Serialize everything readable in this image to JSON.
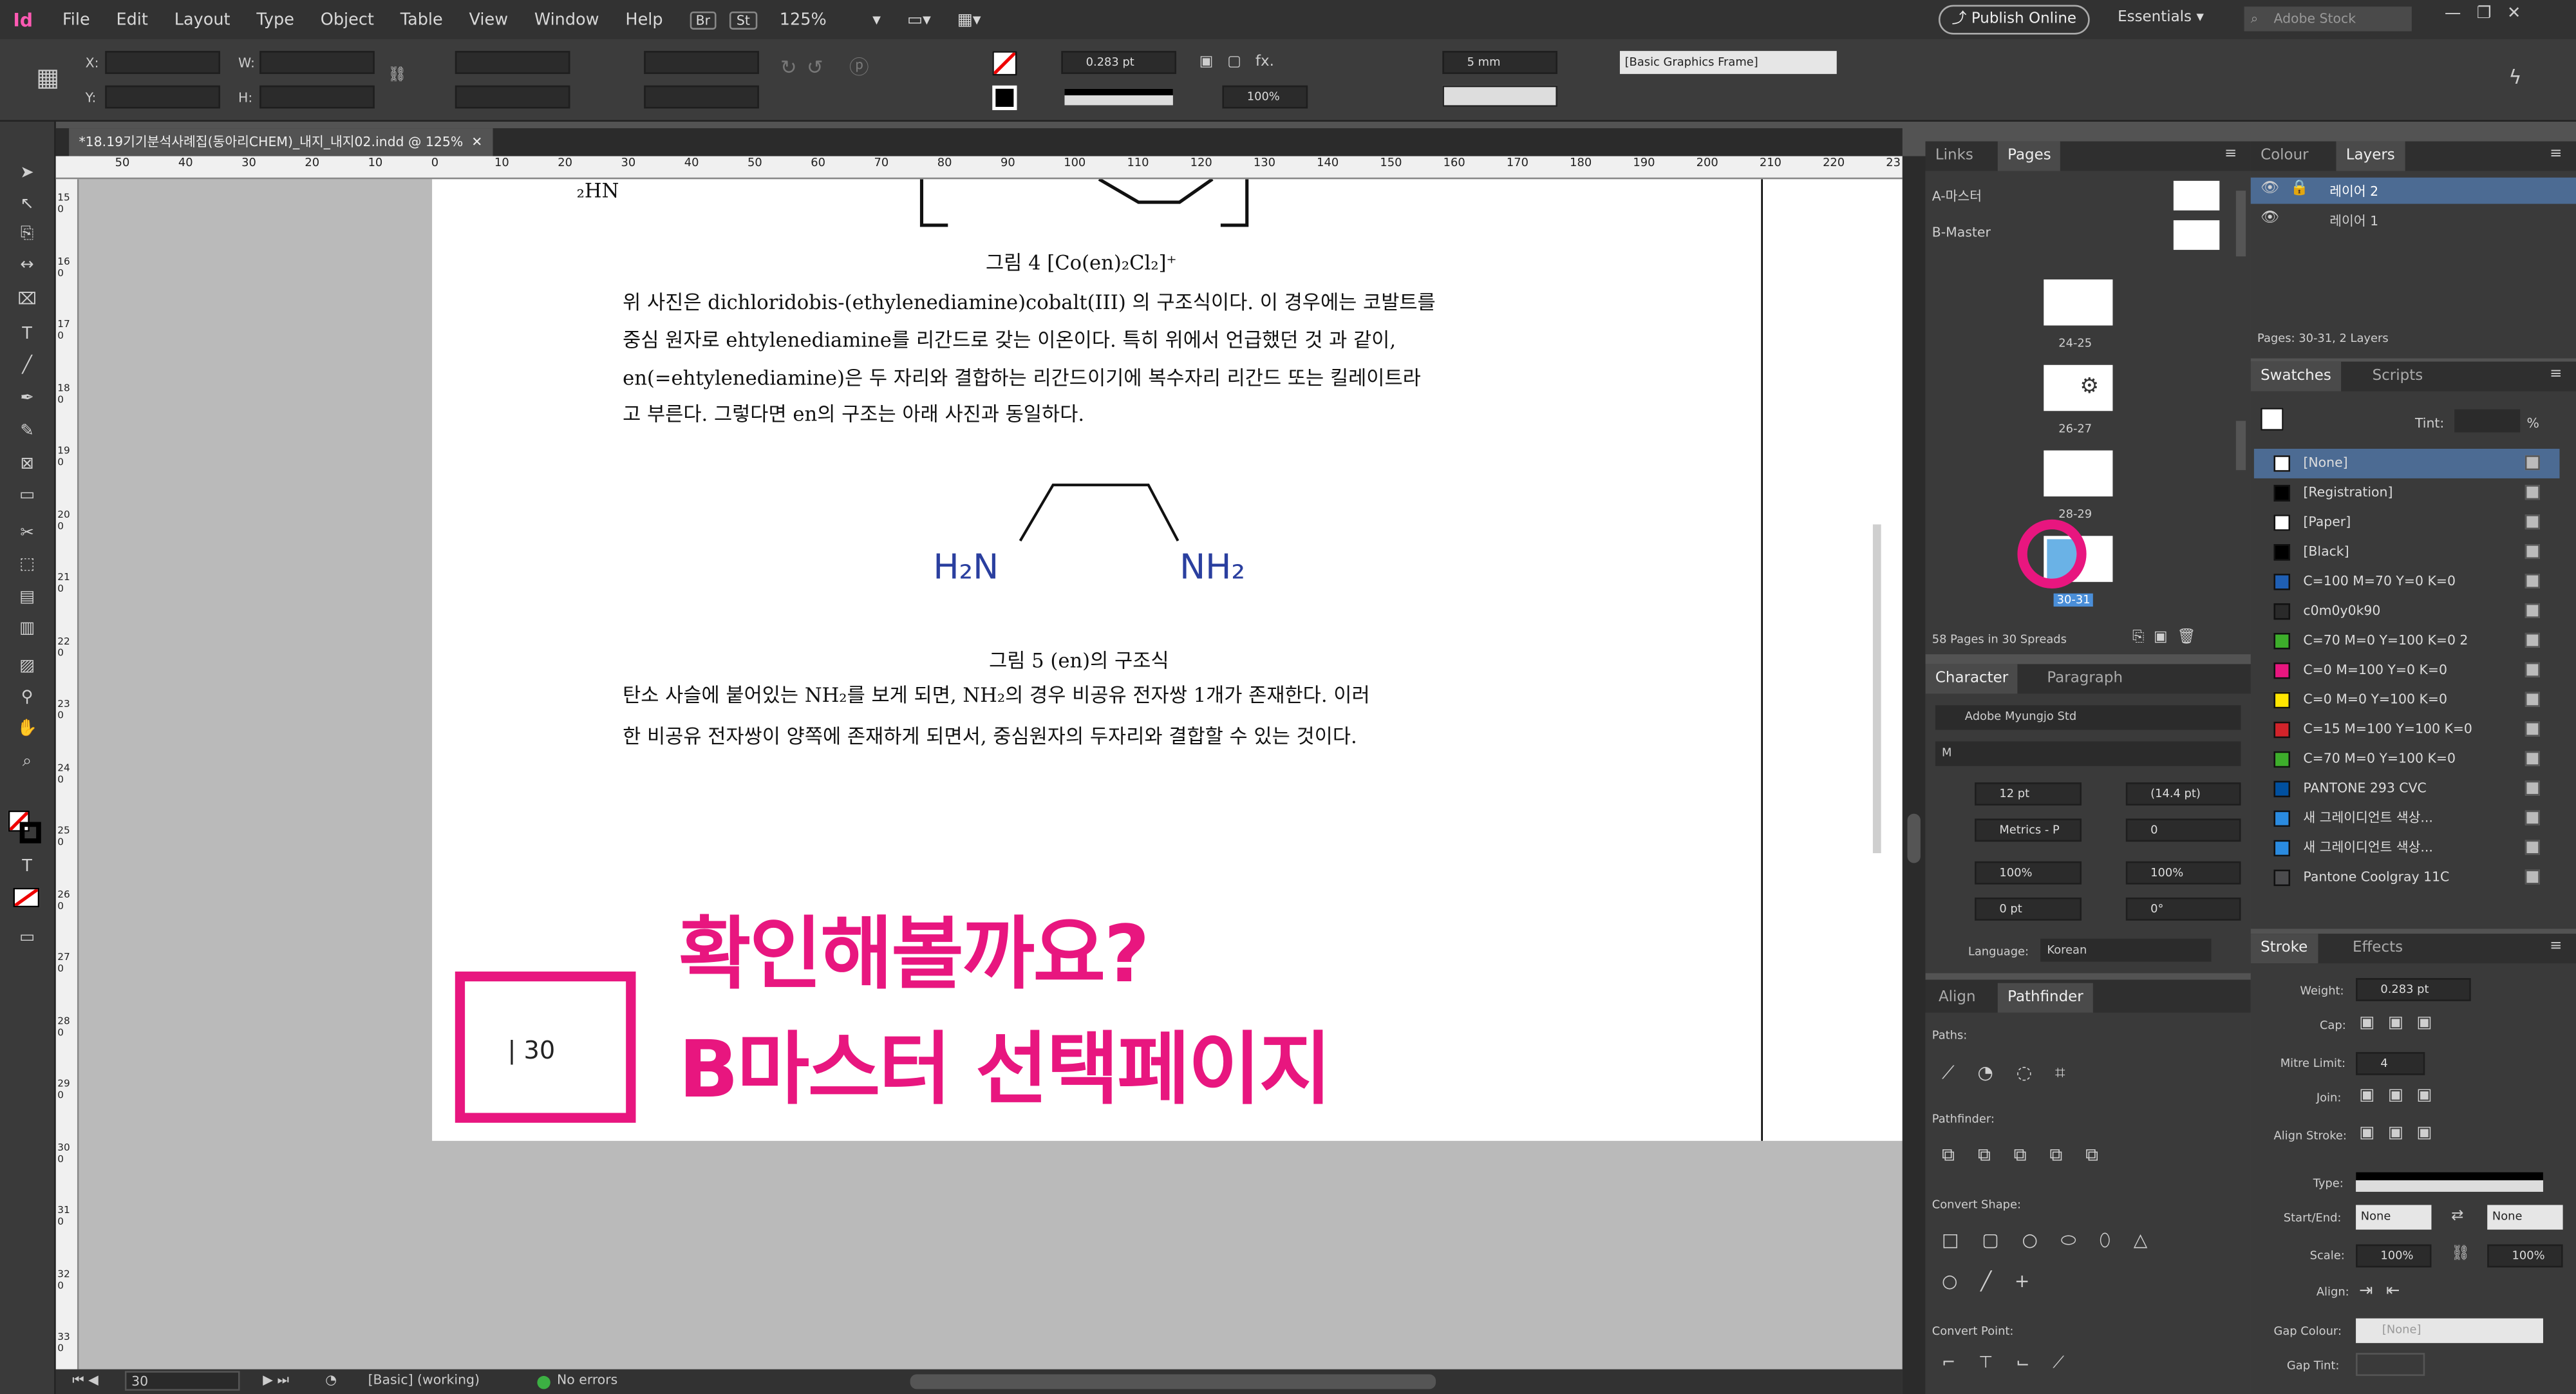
{
  "app": {
    "logo": "Id",
    "menu": [
      "File",
      "Edit",
      "Layout",
      "Type",
      "Object",
      "Table",
      "View",
      "Window",
      "Help"
    ],
    "br": "Br",
    "st": "St",
    "zoom": "125%"
  },
  "topright": {
    "publish": "Publish Online",
    "workspace": "Essentials",
    "search_placeholder": "Adobe Stock"
  },
  "control": {
    "x_label": "X:",
    "y_label": "Y:",
    "w_label": "W:",
    "h_label": "H:",
    "stroke_weight": "0.283 pt",
    "scale": "100%",
    "size_mm": "5 mm",
    "style": "[Basic Graphics Frame]"
  },
  "doc": {
    "tab": "*18.19기기분석사례집(동아리CHEM)_내지_내지02.indd @ 125%"
  },
  "ruler": {
    "h": [
      "50",
      "40",
      "30",
      "20",
      "10",
      "0",
      "10",
      "20",
      "30",
      "40",
      "50",
      "60",
      "70",
      "80",
      "90",
      "100",
      "110",
      "120",
      "130",
      "140",
      "150",
      "160",
      "170",
      "180",
      "190",
      "200",
      "210",
      "220",
      "23"
    ],
    "v": [
      "150",
      "160",
      "170",
      "180",
      "190",
      "200",
      "210",
      "220",
      "230",
      "240",
      "250",
      "260",
      "270",
      "280",
      "290",
      "300",
      "310",
      "320",
      "330"
    ]
  },
  "page": {
    "fig4_caption": "그림 4 [Co(en)₂Cl₂]⁺",
    "para1": [
      "위 사진은 dichloridobis-(ethylenediamine)cobalt(III) 의 구조식이다. 이 경우에는 코발트를",
      "중심 원자로 ehtylenediamine를 리간드로 갖는 이온이다. 특히 위에서 언급했던 것 과 같이,",
      "en(=ehtylenediamine)은 두 자리와 결합하는 리간드이기에 복수자리 리간드 또는 킬레이트라",
      "고 부른다. 그렇다면 en의 구조는 아래 사진과 동일하다."
    ],
    "h2n_left": "H₂N",
    "nh2_right": "NH₂",
    "top_frag": "₂HN",
    "fig5_caption": "그림 5 (en)의 구조식",
    "para2": [
      "탄소 사슬에 붙어있는 NH₂를 보게 되면, NH₂의 경우 비공유 전자쌍 1개가 존재한다. 이러",
      "한 비공유 전자쌍이 양쪽에 존재하게 되면서, 중심원자의 두자리와 결합할 수 있는 것이다."
    ],
    "page_number": "| 30"
  },
  "overlay": {
    "line1": "확인해볼까요?",
    "line2": "B마스터 선택페이지",
    "color": "#e8167f"
  },
  "status": {
    "page": "30",
    "style": "[Basic] (working)",
    "errors": "No errors"
  },
  "pages_panel": {
    "tabs": [
      "Links",
      "Pages"
    ],
    "masters": [
      "A-마스터",
      "B-Master"
    ],
    "spreads": [
      "24-25",
      "26-27",
      "28-29",
      "30-31"
    ],
    "footer": "58 Pages in 30 Spreads"
  },
  "layers_panel": {
    "tabs": [
      "Colour",
      "Layers"
    ],
    "layers": [
      "레이어 2",
      "레이어 1"
    ],
    "footer": "Pages: 30-31, 2 Layers"
  },
  "swatches": {
    "tabs": [
      "Swatches",
      "Scripts"
    ],
    "tint_label": "Tint:",
    "tint_unit": "%",
    "items": [
      {
        "name": "[None]",
        "color": "#ffffff"
      },
      {
        "name": "[Registration]",
        "color": "#000000"
      },
      {
        "name": "[Paper]",
        "color": "#ffffff"
      },
      {
        "name": "[Black]",
        "color": "#000000"
      },
      {
        "name": "C=100 M=70 Y=0 K=0",
        "color": "#1f5fb4"
      },
      {
        "name": "c0m0y0k90",
        "color": "#2a2a2a"
      },
      {
        "name": "C=70 M=0 Y=100 K=0 2",
        "color": "#3dae2b"
      },
      {
        "name": "C=0 M=100 Y=0 K=0",
        "color": "#e8167f"
      },
      {
        "name": "C=0 M=0 Y=100 K=0",
        "color": "#ffe600"
      },
      {
        "name": "C=15 M=100 Y=100 K=0",
        "color": "#d2232a"
      },
      {
        "name": "C=70 M=0 Y=100 K=0",
        "color": "#3dae2b"
      },
      {
        "name": "PANTONE 293 CVC",
        "color": "#0050a0"
      },
      {
        "name": "새 그레이디언트 색상...",
        "color": "#2a8be0"
      },
      {
        "name": "새 그레이디언트 색상...",
        "color": "#2a8be0"
      },
      {
        "name": "Pantone Coolgray 11C",
        "color": "#4b4b4d"
      }
    ]
  },
  "character": {
    "tabs": [
      "Character",
      "Paragraph"
    ],
    "font": "Adobe Myungjo Std",
    "style": "M",
    "size": "12 pt",
    "leading": "(14.4 pt)",
    "kerning": "Metrics - P",
    "tracking": "0",
    "vscale": "100%",
    "hscale": "100%",
    "baseline": "0 pt",
    "skew": "0°",
    "language_label": "Language:",
    "language": "Korean"
  },
  "pathfinder": {
    "tabs": [
      "Align",
      "Pathfinder"
    ],
    "paths": "Paths:",
    "pathfinder": "Pathfinder:",
    "convert_shape": "Convert Shape:",
    "convert_point": "Convert Point:"
  },
  "stroke": {
    "tabs": [
      "Stroke",
      "Effects"
    ],
    "weight_label": "Weight:",
    "weight": "0.283 pt",
    "cap": "Cap:",
    "mitre": "Mitre Limit:",
    "mitre_val": "4",
    "join": "Join:",
    "align": "Align Stroke:",
    "type": "Type:",
    "startend": "Start/End:",
    "start": "None",
    "end": "None",
    "scale": "Scale:",
    "scale1": "100%",
    "scale2": "100%",
    "align2": "Align:",
    "gap_colour": "Gap Colour:",
    "gap_val": "[None]",
    "gap_tint": "Gap Tint:"
  }
}
